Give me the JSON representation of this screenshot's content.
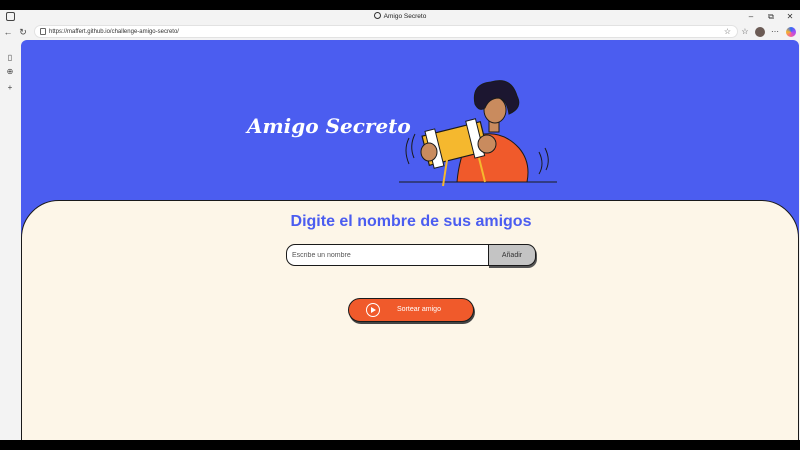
{
  "browser": {
    "tab_title": "Amigo Secreto",
    "url": "https://maffert.github.io/challenge-amigo-secreto/",
    "window_controls": {
      "minimize": "–",
      "restore": "⧉",
      "close": "✕"
    },
    "icons": {
      "workspaces": "tabs-icon",
      "back": "back-arrow-icon",
      "refresh": "refresh-icon",
      "lock": "lock-icon",
      "favorite": "star-icon",
      "favorites": "favorites-icon",
      "more": "more-icon",
      "profile": "avatar",
      "copilot": "copilot-icon"
    }
  },
  "sidebar": {
    "items": [
      "sidebar-tab-icon",
      "sidebar-globe-icon",
      "add-icon"
    ]
  },
  "page": {
    "header_title": "Amigo Secreto",
    "section_title": "Digite el nombre de sus amigos",
    "input": {
      "placeholder": "Escribe un nombre",
      "value": ""
    },
    "add_button_label": "Añadir",
    "draw_button_label": "Sortear amigo",
    "colors": {
      "header_bg": "#4b5df0",
      "main_bg": "#fdf6e8",
      "title_color": "#4b5df0",
      "draw_button": "#f05a2b",
      "add_button": "#c4c4c4"
    }
  }
}
